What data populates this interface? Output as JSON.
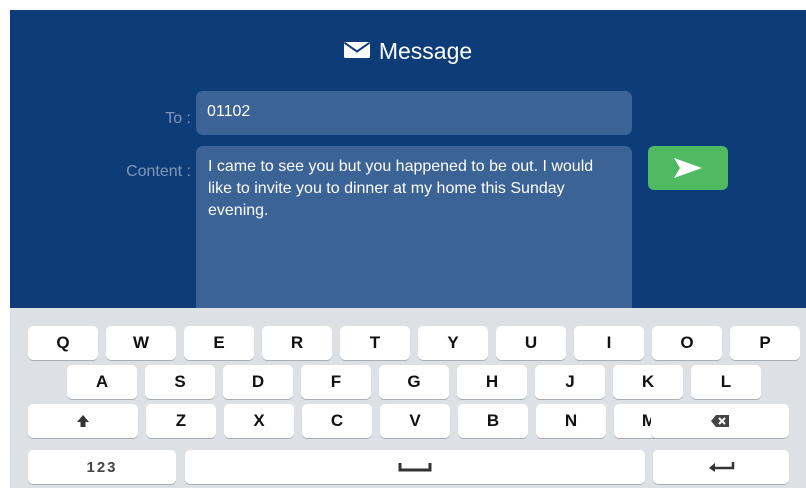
{
  "header": {
    "title": "Message",
    "icon": "envelope-icon"
  },
  "form": {
    "to_label": "To :",
    "to_value": "01102",
    "content_label": "Content :",
    "content_value": "I came to see you but you happened to be out. I would like to invite you to dinner at my home this Sunday evening."
  },
  "send_button": {
    "icon": "send-arrow-icon",
    "color": "#4fba62"
  },
  "keyboard": {
    "row1": [
      "Q",
      "W",
      "E",
      "R",
      "T",
      "Y",
      "U",
      "I",
      "O",
      "P"
    ],
    "row2": [
      "A",
      "S",
      "D",
      "F",
      "G",
      "H",
      "J",
      "K",
      "L"
    ],
    "row3": [
      "Z",
      "X",
      "C",
      "V",
      "B",
      "N",
      "M"
    ],
    "numbers_key": "123",
    "icons": {
      "shift": "shift-arrow-icon",
      "backspace": "backspace-icon",
      "space": "space-icon",
      "return": "return-icon"
    }
  },
  "colors": {
    "header_bg": "#0e3c79",
    "field_bg": "#3b6395",
    "keyboard_bg": "#dde1e6"
  }
}
